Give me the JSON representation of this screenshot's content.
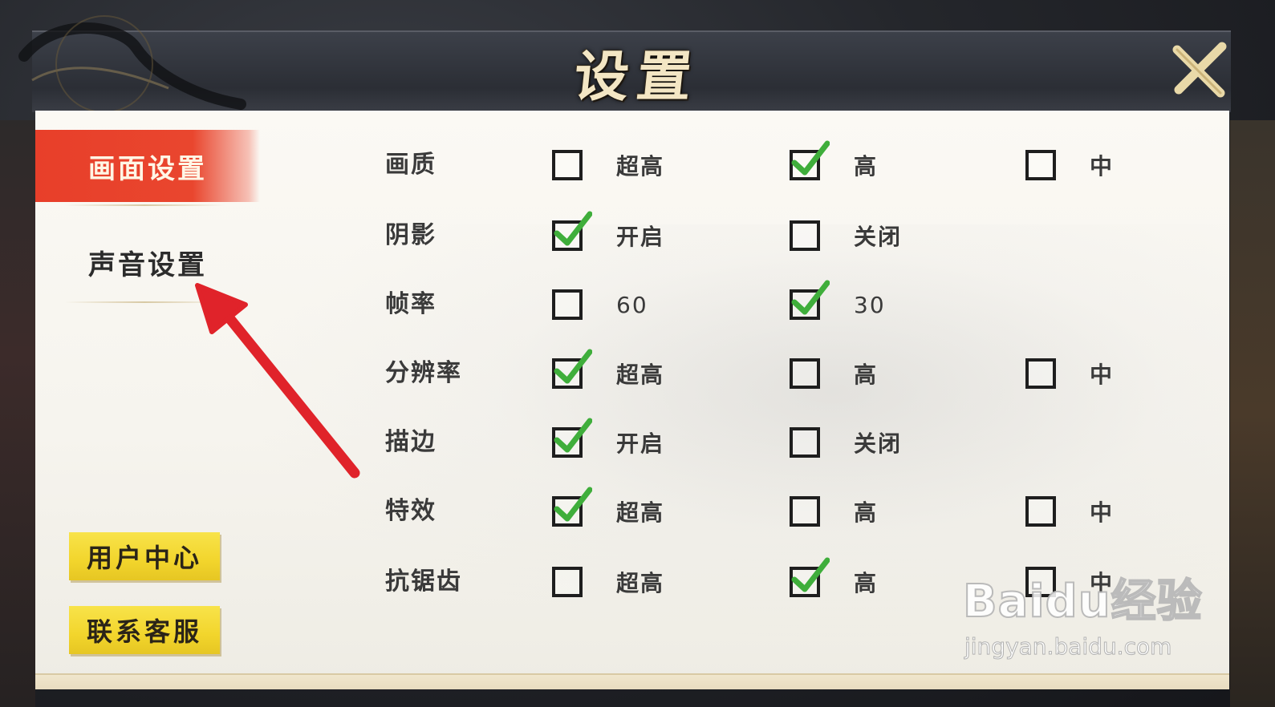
{
  "title": "设置",
  "tabs": [
    {
      "label": "画面设置",
      "active": true
    },
    {
      "label": "声音设置",
      "active": false
    }
  ],
  "side_buttons": {
    "user_center": "用户中心",
    "contact_service": "联系客服"
  },
  "settings": [
    {
      "label": "画质",
      "options": [
        {
          "label": "超高",
          "checked": false
        },
        {
          "label": "高",
          "checked": true
        },
        {
          "label": "中",
          "checked": false
        }
      ]
    },
    {
      "label": "阴影",
      "options": [
        {
          "label": "开启",
          "checked": true
        },
        {
          "label": "关闭",
          "checked": false
        }
      ]
    },
    {
      "label": "帧率",
      "options": [
        {
          "label": "60",
          "checked": false
        },
        {
          "label": "30",
          "checked": true
        }
      ]
    },
    {
      "label": "分辨率",
      "options": [
        {
          "label": "超高",
          "checked": true
        },
        {
          "label": "高",
          "checked": false
        },
        {
          "label": "中",
          "checked": false
        }
      ]
    },
    {
      "label": "描边",
      "options": [
        {
          "label": "开启",
          "checked": true
        },
        {
          "label": "关闭",
          "checked": false
        }
      ]
    },
    {
      "label": "特效",
      "options": [
        {
          "label": "超高",
          "checked": true
        },
        {
          "label": "高",
          "checked": false
        },
        {
          "label": "中",
          "checked": false
        }
      ]
    },
    {
      "label": "抗锯齿",
      "options": [
        {
          "label": "超高",
          "checked": false
        },
        {
          "label": "高",
          "checked": true
        },
        {
          "label": "中",
          "checked": false
        }
      ]
    }
  ],
  "watermark": {
    "brand": "Baidu经验",
    "url": "jingyan.baidu.com"
  },
  "colors": {
    "active_tab": "#e9462e",
    "side_button": "#f2d52c",
    "check": "#3fae3b",
    "arrow": "#e0232a"
  }
}
